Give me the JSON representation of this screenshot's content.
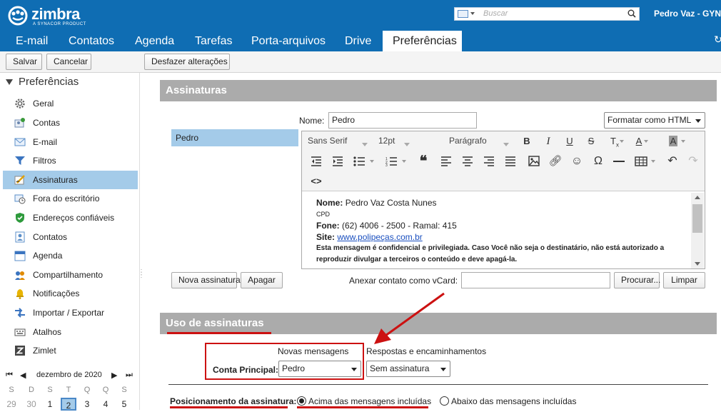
{
  "brand": {
    "name": "zimbra",
    "tagline": "A SYNACOR PRODUCT"
  },
  "search": {
    "placeholder": "Buscar"
  },
  "user": {
    "name": "Pedro Vaz - GYN"
  },
  "tabs": [
    "E-mail",
    "Contatos",
    "Agenda",
    "Tarefas",
    "Porta-arquivos",
    "Drive",
    "Preferências"
  ],
  "active_tab": "Preferências",
  "toolbar": {
    "save": "Salvar",
    "cancel": "Cancelar",
    "undo": "Desfazer alterações"
  },
  "sidebar": {
    "title": "Preferências",
    "items": [
      {
        "label": "Geral",
        "icon": "gear-icon"
      },
      {
        "label": "Contas",
        "icon": "accounts-icon"
      },
      {
        "label": "E-mail",
        "icon": "mail-icon"
      },
      {
        "label": "Filtros",
        "icon": "filter-icon"
      },
      {
        "label": "Assinaturas",
        "icon": "signature-icon"
      },
      {
        "label": "Fora do escritório",
        "icon": "out-of-office-icon"
      },
      {
        "label": "Endereços confiáveis",
        "icon": "shield-icon"
      },
      {
        "label": "Contatos",
        "icon": "contacts-icon"
      },
      {
        "label": "Agenda",
        "icon": "calendar-icon"
      },
      {
        "label": "Compartilhamento",
        "icon": "sharing-icon"
      },
      {
        "label": "Notificações",
        "icon": "bell-icon"
      },
      {
        "label": "Importar / Exportar",
        "icon": "import-export-icon"
      },
      {
        "label": "Atalhos",
        "icon": "keyboard-icon"
      },
      {
        "label": "Zimlet",
        "icon": "zimlet-icon"
      }
    ],
    "selected": "Assinaturas"
  },
  "calendar": {
    "month": "dezembro de 2020",
    "weekdays": [
      "D",
      "S",
      "T",
      "Q",
      "Q",
      "S",
      "S"
    ],
    "days": [
      "29",
      "30",
      "1",
      "2",
      "3",
      "4",
      "5"
    ],
    "today": "2"
  },
  "signatures": {
    "section_title": "Assinaturas",
    "name_label": "Nome:",
    "name_value": "Pedro",
    "format_select": "Formatar como HTML",
    "list": [
      "Pedro"
    ],
    "font_family": "Sans Serif",
    "font_size": "12pt",
    "paragraph": "Parágrafo",
    "body": {
      "name_label": "Nome:",
      "name_value": "Pedro Vaz Costa Nunes",
      "dept": "CPD",
      "phone_label": "Fone:",
      "phone_value": "(62) 4006 - 2500 - Ramal: 415",
      "site_label": "Site:",
      "site_value": "www.polipeças.com.br",
      "disclaimer_1": "Esta mensagem é confidencial e privilegiada. Caso Você não seja o destinatário, não está autorizado a",
      "disclaimer_2": "reproduzir divulgar a terceiros o conteúdo e deve apagá-la."
    },
    "new_button": "Nova assinatura",
    "delete_button": "Apagar",
    "vcard_label": "Anexar contato como vCard:",
    "vcard_value": "",
    "browse_button": "Procurar...",
    "clear_button": "Limpar"
  },
  "usage": {
    "section_title": "Uso de assinaturas",
    "col_new": "Novas mensagens",
    "col_reply": "Respostas e encaminhamentos",
    "account_label": "Conta Principal:",
    "new_select": "Pedro",
    "reply_select": "Sem assinatura",
    "position_label": "Posicionamento da assinatura:",
    "option_above": "Acima das mensagens incluídas",
    "option_below": "Abaixo das mensagens incluídas",
    "selected_option": "above"
  },
  "colors": {
    "topbar": "#0f6db3",
    "selection": "#a4cbe9",
    "section_bar": "#ababab",
    "annotation_red": "#cc1111"
  }
}
